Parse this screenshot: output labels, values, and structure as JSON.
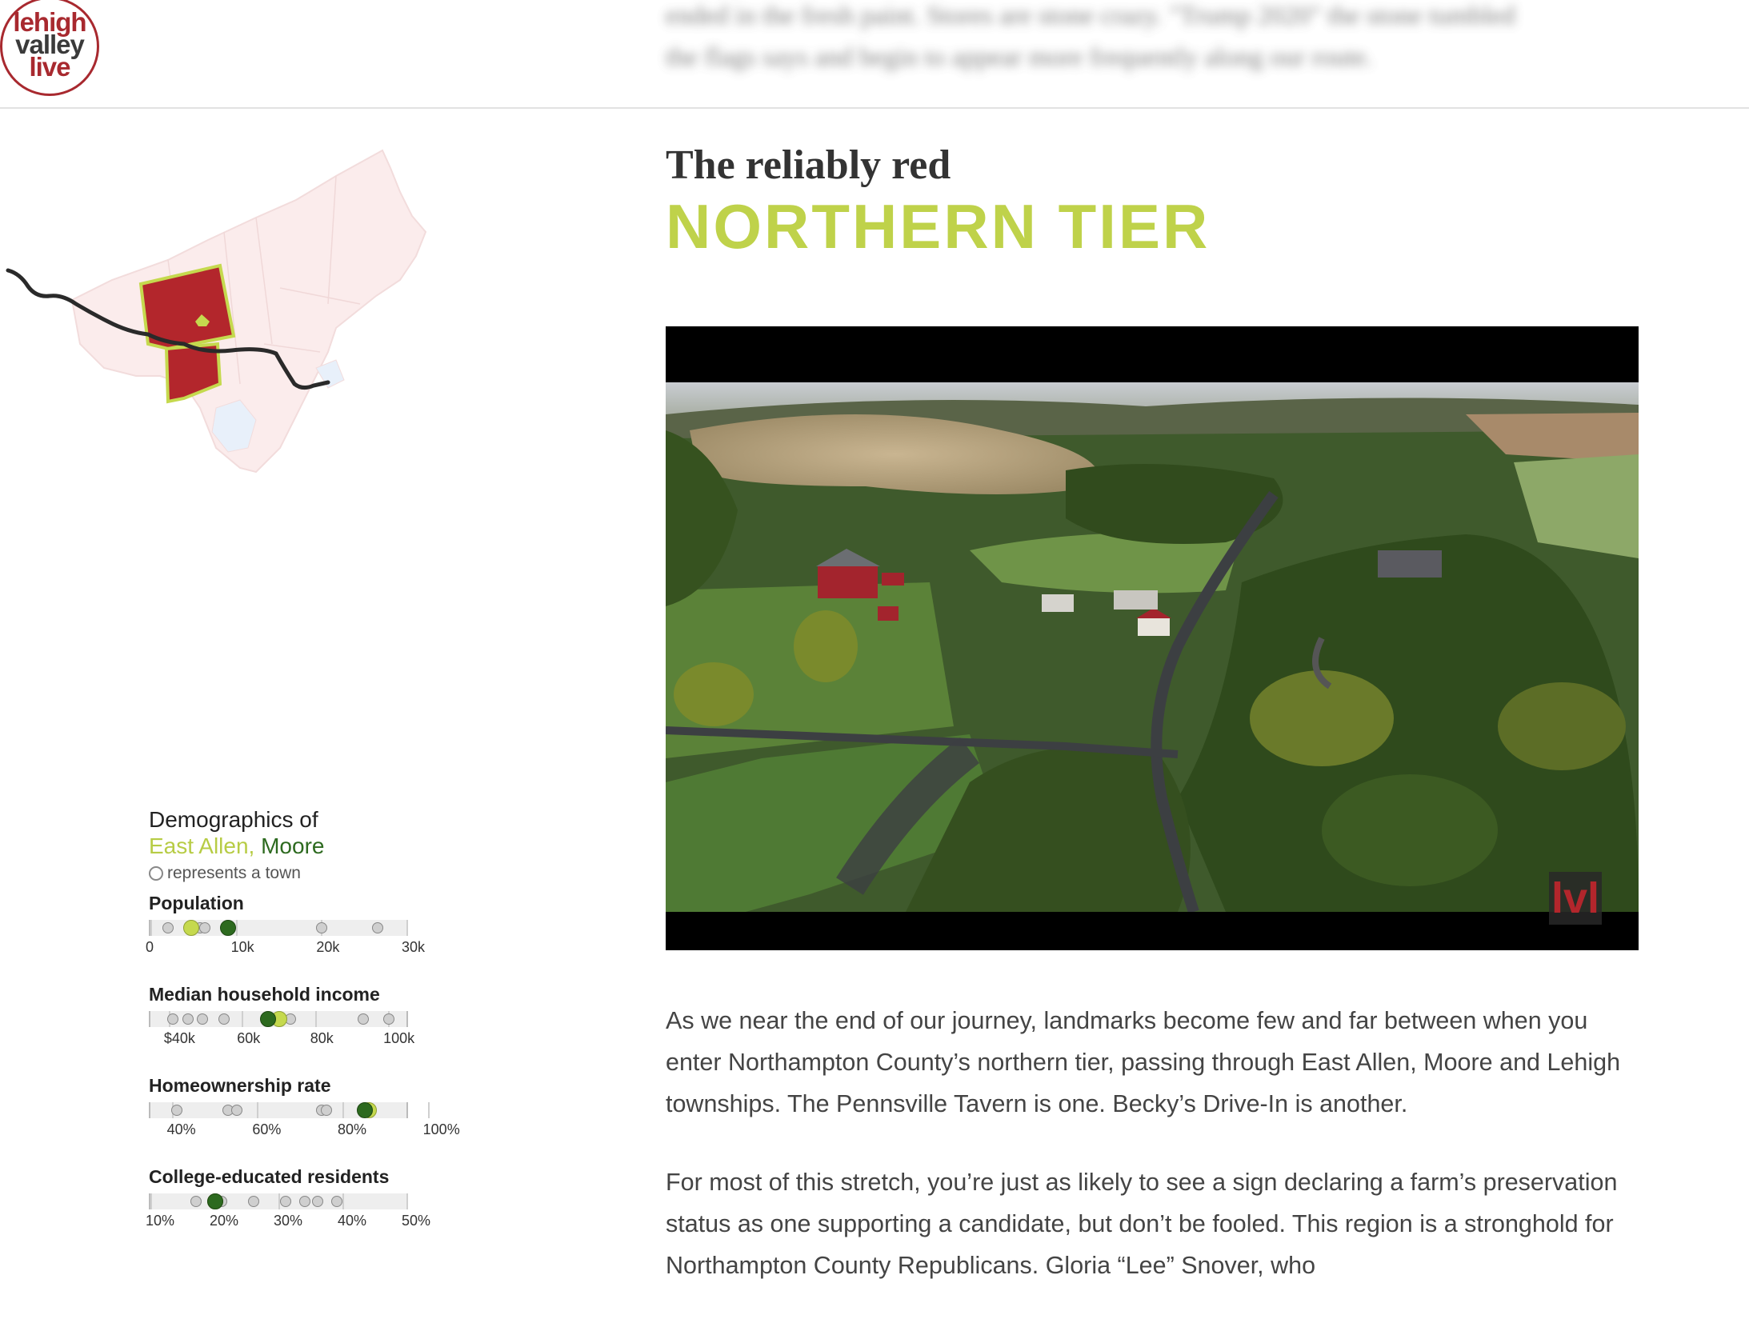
{
  "header": {
    "logo": {
      "line1": "lehigh",
      "line2": "valley",
      "line3": "live"
    },
    "blurred_text_line1": "ended in the fresh paint. Stores are stone crazy. \"Trump 2020\" the stone tumbled",
    "blurred_text_line2": "the flags says and begin to appear more frequently along our route."
  },
  "section": {
    "kicker": "The reliably red",
    "headline": "NORTHERN TIER"
  },
  "video": {
    "watermark": "lvl"
  },
  "demographics": {
    "title": "Demographics of",
    "town_a": "East Allen",
    "separator": ",",
    "town_b": "Moore",
    "legend": "represents a town",
    "colors": {
      "town_a": "#c5d94e",
      "town_b": "#2d6a1f"
    },
    "metrics": [
      {
        "label": "Population",
        "axis_labels": [
          "0",
          "10k",
          "20k",
          "30k"
        ],
        "axis_values": [
          0,
          10000,
          20000,
          30000
        ],
        "domain": [
          0,
          30000
        ],
        "towns": [
          2000,
          5000,
          5700,
          6300,
          20000,
          26500
        ],
        "town_a_value": 4700,
        "town_b_value": 9000
      },
      {
        "label": "Median household income",
        "axis_labels": [
          "$40k",
          "60k",
          "80k",
          "100k"
        ],
        "axis_values": [
          40000,
          60000,
          80000,
          100000
        ],
        "domain": [
          35000,
          105000
        ],
        "towns": [
          41000,
          45000,
          49000,
          55000,
          73000,
          93000,
          100000
        ],
        "town_a_value": 70000,
        "town_b_value": 67000
      },
      {
        "label": "Homeownership rate",
        "axis_labels": [
          "40%",
          "60%",
          "80%",
          "100%"
        ],
        "axis_values": [
          40,
          60,
          80,
          100
        ],
        "domain": [
          35,
          95
        ],
        "towns": [
          41,
          53,
          55,
          75,
          76
        ],
        "town_a_value": 86,
        "town_b_value": 85
      },
      {
        "label": "College-educated residents",
        "axis_labels": [
          "10%",
          "20%",
          "30%",
          "40%",
          "50%"
        ],
        "axis_values": [
          10,
          20,
          30,
          40,
          50
        ],
        "domain": [
          10,
          50
        ],
        "towns": [
          17,
          21,
          26,
          31,
          34,
          36,
          39
        ],
        "town_a_value": 20,
        "town_b_value": 20
      }
    ]
  },
  "body": {
    "paragraph1": "As we near the end of our journey, landmarks become few and far between when you enter Northampton County’s northern tier, passing through East Allen, Moore and Lehigh townships. The Pennsville Tavern is one. Becky’s Drive-In is another.",
    "paragraph2": "For most of this stretch, you’re just as likely to see a sign declaring a farm’s preservation status as one supporting a candidate, but don’t be fooled. This region is a stronghold for Northampton County Republicans. Gloria “Lee” Snover, who"
  }
}
